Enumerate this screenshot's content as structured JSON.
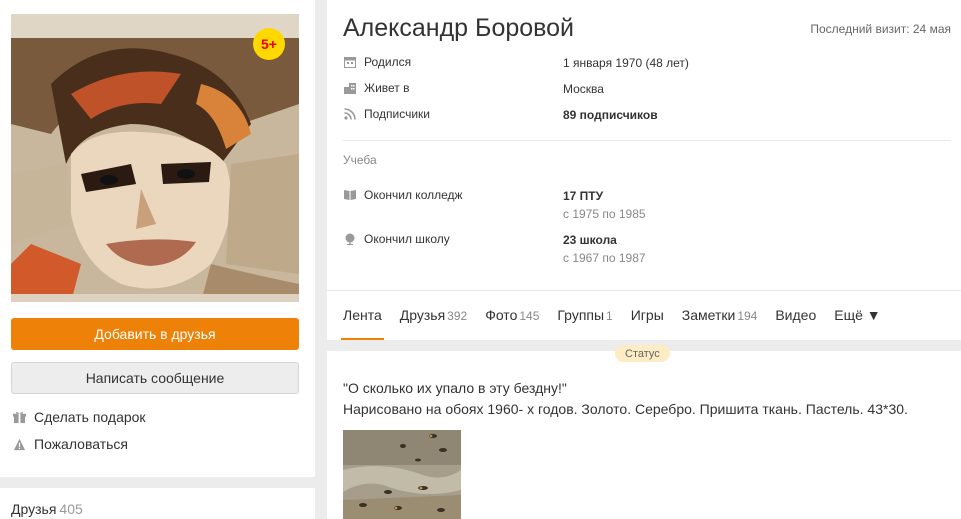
{
  "profile": {
    "age_badge": "5+",
    "add_friend_label": "Добавить в друзья",
    "message_label": "Написать сообщение",
    "gift_label": "Сделать подарок",
    "report_label": "Пожаловаться",
    "friends_label": "Друзья",
    "friends_count": "405"
  },
  "info": {
    "name": "Александр Боровой",
    "last_visit": "Последний визит: 24 мая",
    "rows": [
      {
        "label": "Родился",
        "value": "1 января 1970 (48 лет)",
        "icon": "calendar-icon"
      },
      {
        "label": "Живет в",
        "value": "Москва",
        "icon": "home-icon"
      },
      {
        "label": "Подписчики",
        "value": "89 подписчиков",
        "icon": "rss-icon"
      }
    ],
    "section_label": "Учеба",
    "edu": [
      {
        "label": "Окончил колледж",
        "value": "17 ПТУ",
        "sub": "с 1975 по 1985",
        "icon": "book-icon"
      },
      {
        "label": "Окончил школу",
        "value": "23 школа",
        "sub": "с 1967 по 1987",
        "icon": "globe-icon"
      }
    ]
  },
  "tabs": [
    {
      "label": "Лента",
      "count": ""
    },
    {
      "label": "Друзья",
      "count": "392"
    },
    {
      "label": "Фото",
      "count": "145"
    },
    {
      "label": "Группы",
      "count": "1"
    },
    {
      "label": "Игры",
      "count": ""
    },
    {
      "label": "Заметки",
      "count": "194"
    },
    {
      "label": "Видео",
      "count": ""
    },
    {
      "label": "Ещё ▼",
      "count": ""
    }
  ],
  "post": {
    "badge": "Статус",
    "line1": "\"О сколько их упало в эту бездну!\"",
    "line2": "Нарисовано на обоях 1960- х годов. Золото. Серебро. Пришита ткань. Пастель. 43*30."
  },
  "colors": {
    "accent": "#ee8208",
    "badge_bg": "#ffd800",
    "badge_text": "#e00000"
  }
}
